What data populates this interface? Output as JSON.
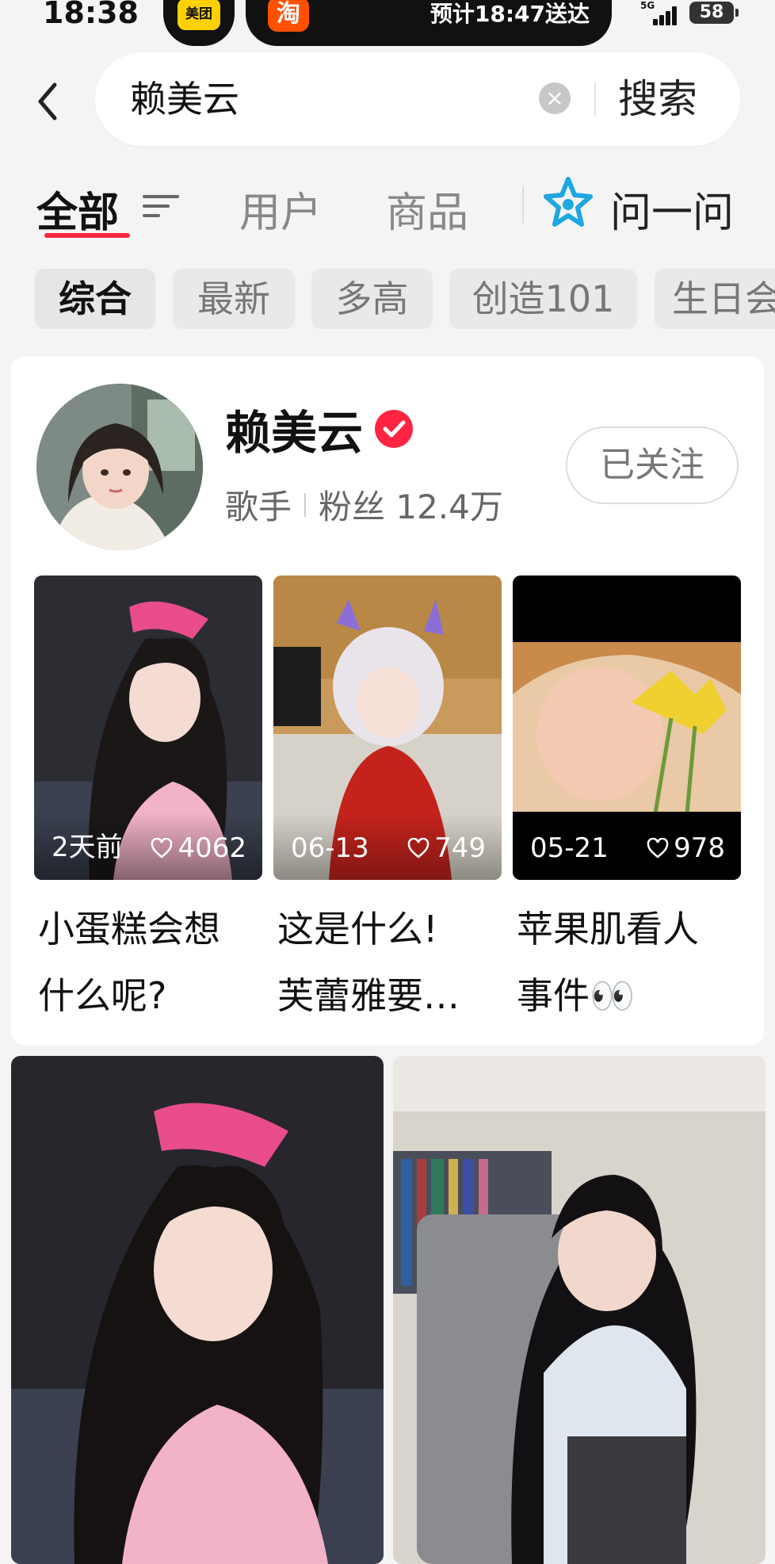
{
  "status_bar": {
    "time": "18:38",
    "meituan_label": "美团",
    "taobao_label": "淘",
    "delivery_text": "预计18:47送达",
    "network": "5G",
    "battery": "58"
  },
  "search": {
    "query": "赖美云",
    "submit_label": "搜索"
  },
  "tabs": [
    {
      "label": "全部",
      "active": true
    },
    {
      "label": "用户",
      "active": false
    },
    {
      "label": "商品",
      "active": false
    },
    {
      "label": "问一问",
      "active": false
    }
  ],
  "chips": [
    {
      "label": "综合",
      "active": true
    },
    {
      "label": "最新",
      "active": false
    },
    {
      "label": "多高",
      "active": false
    },
    {
      "label": "创造101",
      "active": false
    },
    {
      "label": "生日会",
      "active": false
    }
  ],
  "user_card": {
    "name": "赖美云",
    "role": "歌手",
    "followers": "粉丝 12.4万",
    "follow_label": "已关注",
    "posts": [
      {
        "date": "2天前",
        "likes": "4062",
        "title_line1": "小蛋糕会想",
        "title_line2": "什么呢?"
      },
      {
        "date": "06-13",
        "likes": "749",
        "title_line1": "这是什么!",
        "title_line2": "芙蕾雅要…"
      },
      {
        "date": "05-21",
        "likes": "978",
        "title_line1": "苹果肌看人",
        "title_line2": "事件👀"
      }
    ]
  },
  "colors": {
    "accent": "#ff2442",
    "background": "#f4f4f4",
    "ask_icon": "#1ea7e1"
  },
  "icons": [
    "back-arrow-icon",
    "clear-icon",
    "filter-icon",
    "ask-star-icon",
    "verified-icon",
    "heart-icon"
  ]
}
